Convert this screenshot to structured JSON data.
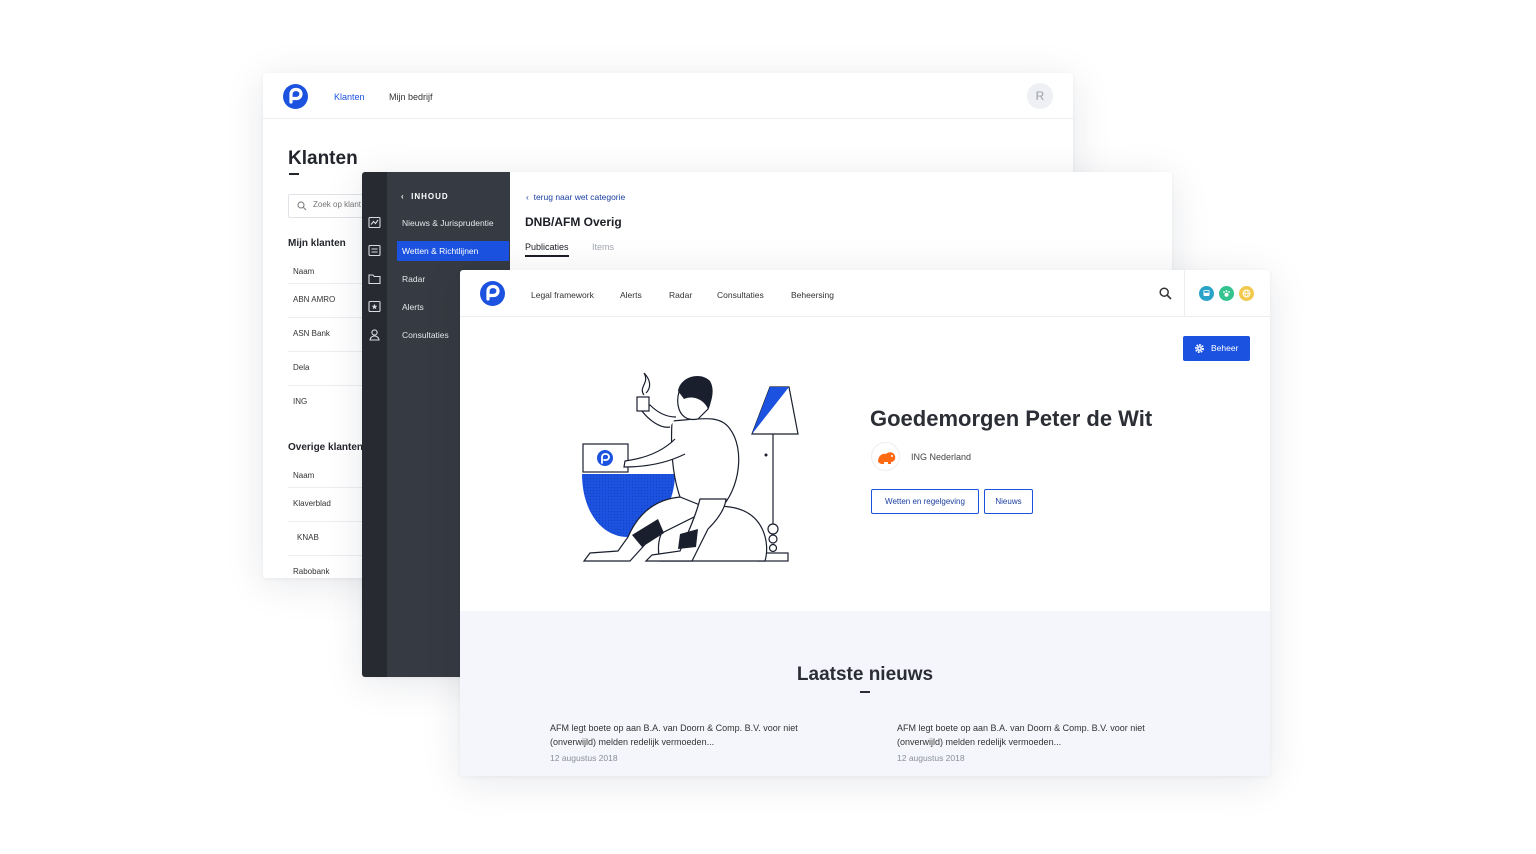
{
  "klanten_window": {
    "nav": [
      "Klanten",
      "Mijn bedrijf"
    ],
    "avatar_initial": "R",
    "title": "Klanten",
    "search_placeholder": "Zoek op klant",
    "mijn_klanten": {
      "heading": "Mijn klanten",
      "column": "Naam",
      "rows": [
        "ABN AMRO",
        "ASN Bank",
        "Dela",
        "ING"
      ]
    },
    "overige_klanten": {
      "heading": "Overige klanten",
      "column": "Naam",
      "rows": [
        "Klaverblad",
        "KNAB",
        "Rabobank"
      ]
    }
  },
  "inhoud_window": {
    "sidebar_header": "INHOUD",
    "sidebar_items": [
      "Nieuws & Jurisprudentie",
      "Wetten & Richtlijnen",
      "Radar",
      "Alerts",
      "Consultaties"
    ],
    "active_item": "Wetten & Richtlijnen",
    "rail_icons": [
      "chart-icon",
      "list-icon",
      "folder-icon",
      "star-icon",
      "user-icon"
    ],
    "back_link": "terug naar wet categorie",
    "title": "DNB/AFM Overig",
    "tabs": [
      "Publicaties",
      "Items"
    ]
  },
  "main_window": {
    "nav": [
      "Legal framework",
      "Alerts",
      "Radar",
      "Consultaties",
      "Beheersing"
    ],
    "status_colors": [
      "#2aa3c9",
      "#34c38f",
      "#f2c94c"
    ],
    "beheer_button": "Beheer",
    "greeting": "Goedemorgen Peter de Wit",
    "organisation": "ING Nederland",
    "buttons": [
      "Wetten en regelgeving",
      "Nieuws"
    ],
    "news": {
      "heading": "Laatste nieuws",
      "articles": [
        {
          "text": "AFM legt boete op aan B.A. van Doorn & Comp. B.V. voor niet (onverwijld) melden redelijk vermoeden...",
          "date": "12 augustus 2018"
        },
        {
          "text": "AFM legt boete op aan B.A. van Doorn & Comp. B.V. voor niet (onverwijld) melden redelijk vermoeden...",
          "date": "12 augustus 2018"
        }
      ]
    }
  },
  "colors": {
    "brand": "#1b52e0",
    "sidebar_dark": "#272b31",
    "sidebar": "#363a42",
    "news_bg": "#f4f6fb"
  }
}
